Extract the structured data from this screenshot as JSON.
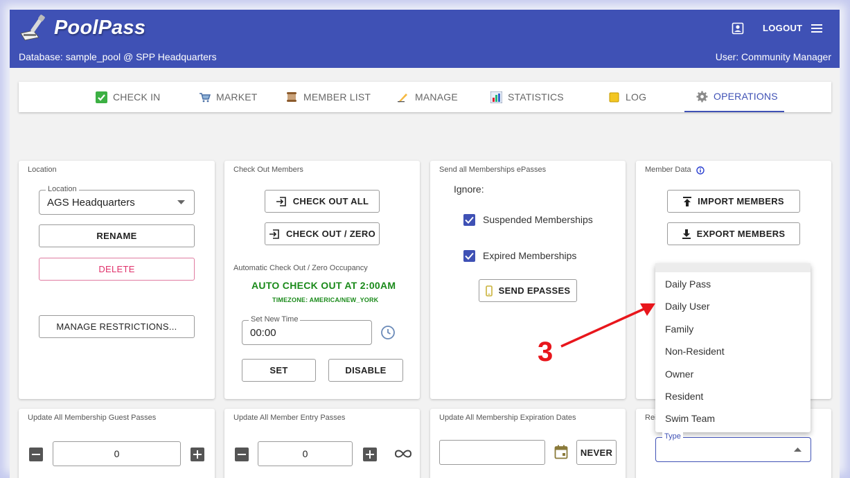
{
  "header": {
    "app_name": "PoolPass",
    "database_line": "Database: sample_pool @ SPP Headquarters",
    "user_line": "User: Community Manager",
    "logout_label": "LOGOUT",
    "icons": {
      "logo": "scraper-logo-icon",
      "profile": "account-box-icon",
      "menu": "hamburger-menu-icon"
    }
  },
  "tabs": [
    {
      "label": "CHECK IN",
      "icon": "check-mark-icon"
    },
    {
      "label": "MARKET",
      "icon": "shopping-cart-icon"
    },
    {
      "label": "MEMBER LIST",
      "icon": "scroll-icon"
    },
    {
      "label": "MANAGE",
      "icon": "writing-hand-icon"
    },
    {
      "label": "STATISTICS",
      "icon": "bar-chart-icon"
    },
    {
      "label": "LOG",
      "icon": "notepad-icon"
    },
    {
      "label": "OPERATIONS",
      "icon": "gear-icon",
      "active": true
    }
  ],
  "location_card": {
    "title": "Location",
    "field_label": "Location",
    "field_value": "AGS Headquarters",
    "rename_label": "RENAME",
    "delete_label": "DELETE",
    "restrictions_label": "MANAGE RESTRICTIONS..."
  },
  "checkout_card": {
    "title": "Check Out Members",
    "check_out_all_label": "CHECK OUT ALL",
    "check_out_zero_label": "CHECK OUT / ZERO",
    "auto_title": "Automatic Check Out / Zero Occupancy",
    "auto_status": "AUTO CHECK OUT AT 2:00AM",
    "timezone": "TIMEZONE: AMERICA/NEW_YORK",
    "time_field_label": "Set New Time",
    "time_field_value": "00:00",
    "set_label": "SET",
    "disable_label": "DISABLE"
  },
  "epass_card": {
    "title": "Send all Memberships ePasses",
    "ignore_label": "Ignore:",
    "suspended_label": "Suspended Memberships",
    "expired_label": "Expired Memberships",
    "send_label": "SEND EPASSES"
  },
  "member_data_card": {
    "title": "Member Data",
    "import_label": "IMPORT MEMBERS",
    "export_label": "EXPORT MEMBERS"
  },
  "type_dropdown": {
    "options": [
      "Daily Pass",
      "Daily User",
      "Family",
      "Non-Resident",
      "Owner",
      "Resident",
      "Swim Team"
    ],
    "field_label": "Type"
  },
  "bottom_cards": {
    "guest_passes_title": "Update All Membership Guest Passes",
    "guest_passes_value": "0",
    "entry_passes_title": "Update All Member Entry Passes",
    "entry_passes_value": "0",
    "expiration_title": "Update All Membership Expiration Dates",
    "never_label": "NEVER",
    "fourth_title_visible": "Rei"
  },
  "annotation": {
    "number": "3",
    "color": "#e8161c"
  },
  "colors": {
    "primary": "#3f51b5",
    "green": "#1a8a1a",
    "delete": "#e0306a"
  }
}
